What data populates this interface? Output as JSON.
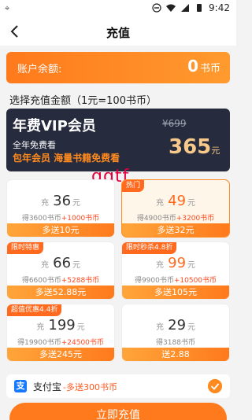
{
  "status_bar": {
    "time": "9:42",
    "left_text": "⌖"
  },
  "nav": {
    "title": "充值"
  },
  "balance": {
    "label": "账户余额:",
    "value": "0",
    "unit": "书币"
  },
  "section_title": "选择充值金额（1元=100书币）",
  "vip": {
    "title": "年费VIP会员",
    "subtitle": "全年免费看",
    "highlight": "包年会员 海量书籍免费看",
    "old_price": "¥699",
    "price": "365",
    "price_unit": "元"
  },
  "watermark": "qqtf",
  "packages": [
    {
      "badge": "",
      "prefix": "充",
      "amount": "36",
      "unit": "元",
      "desc_base": "得3600书币",
      "desc_bonus": "+1000书币",
      "bottom": "多送10元"
    },
    {
      "badge": "热门",
      "prefix": "充",
      "amount": "49",
      "unit": "元",
      "desc_base": "得4900书币",
      "desc_bonus": "+3200书币",
      "bottom": "多送32元"
    },
    {
      "badge": "限时特惠",
      "prefix": "充",
      "amount": "66",
      "unit": "元",
      "desc_base": "得6600书币",
      "desc_bonus": "+5288书币",
      "bottom": "多送52.88元"
    },
    {
      "badge": "限时秒杀4.8折",
      "prefix": "充",
      "amount": "99",
      "unit": "元",
      "desc_base": "得9900书币",
      "desc_bonus": "+10500书币",
      "bottom": "多送105元"
    },
    {
      "badge": "超值优惠4.4折",
      "prefix": "充",
      "amount": "199",
      "unit": "元",
      "desc_base": "得19900书币",
      "desc_bonus": "+24500书币",
      "bottom": "多送245元"
    },
    {
      "badge": "",
      "prefix": "充",
      "amount": "29",
      "unit": "元",
      "desc_base": "得3188书币",
      "desc_bonus": "",
      "bottom": "送2.88"
    }
  ],
  "payment": {
    "icon_text": "支",
    "name": "支付宝",
    "promo": "-多送300书币"
  },
  "submit_label": "立即充值",
  "colors": {
    "accent": "#ff7a1c",
    "vip_bg": "#262b3d",
    "bonus": "#ff4a1f"
  },
  "icons": {
    "back": "chevron-left-icon",
    "check": "check-circle-icon",
    "alipay": "alipay-icon"
  }
}
